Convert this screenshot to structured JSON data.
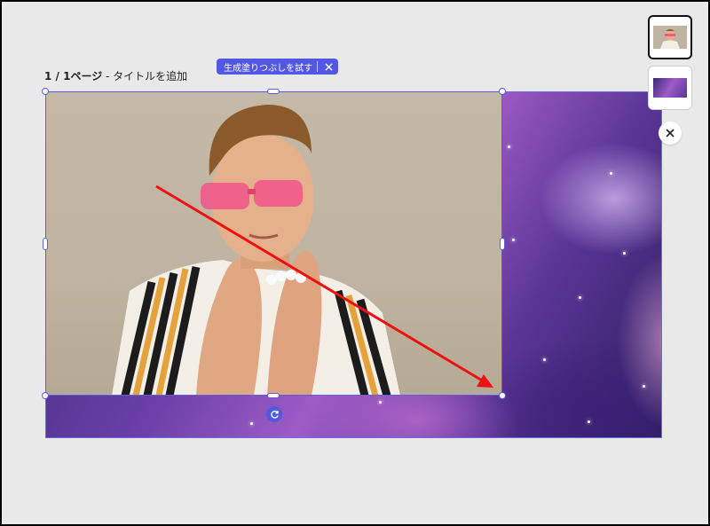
{
  "page_label": {
    "prefix": "1 / 1ページ",
    "separator": " - ",
    "title_placeholder": "タイトルを追加"
  },
  "generative_fill": {
    "label": "生成塗りつぶしを試す",
    "close_icon": "close-icon"
  },
  "canvas": {
    "background_image": "purple-galaxy-nebula",
    "foreground_image": "man-with-pink-sunglasses",
    "rotate_icon": "rotate-icon"
  },
  "thumbnails": [
    {
      "name": "portrait-thumbnail",
      "active": true
    },
    {
      "name": "galaxy-thumbnail",
      "active": false
    }
  ],
  "close_panel_icon": "close-icon",
  "colors": {
    "accent": "#5258e4",
    "canvas_bg": "#e9e9e9",
    "annotation_arrow": "#ee1111"
  }
}
